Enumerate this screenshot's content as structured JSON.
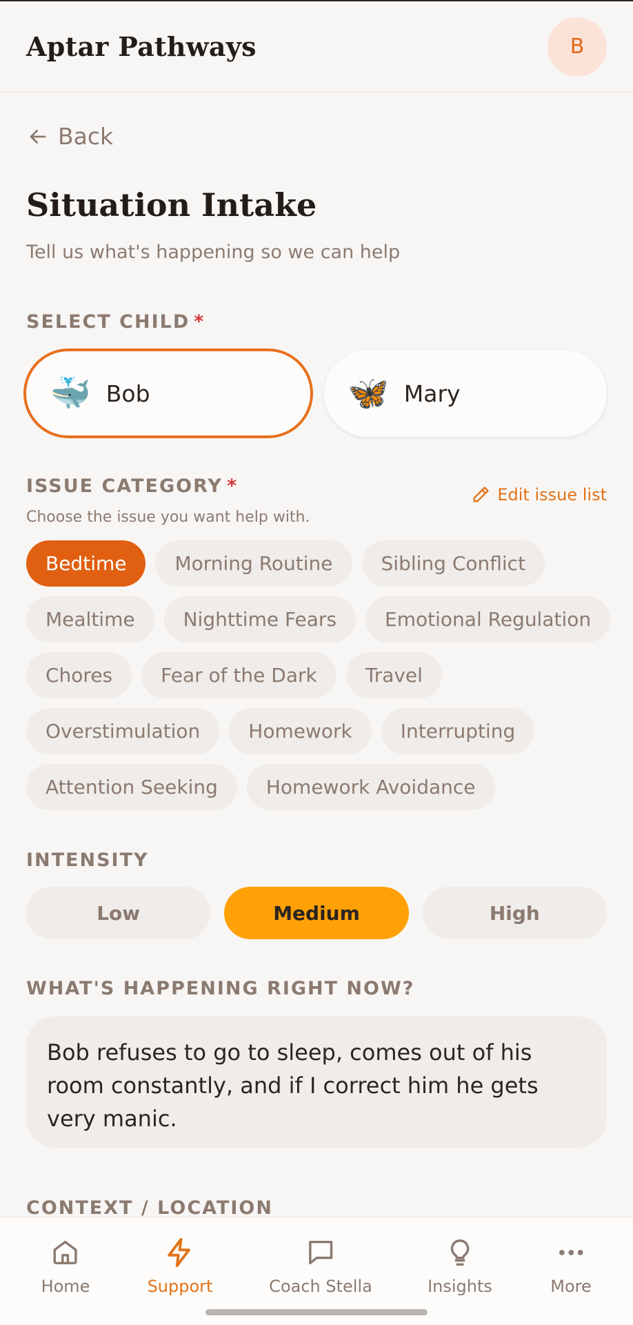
{
  "header": {
    "app_title": "Aptar Pathways",
    "avatar_initial": "B"
  },
  "nav": {
    "back_label": "Back"
  },
  "page": {
    "title": "Situation Intake",
    "subtitle": "Tell us what's happening so we can help"
  },
  "select_child": {
    "label": "SELECT CHILD",
    "required_mark": "*",
    "children": [
      {
        "name": "Bob",
        "emoji": "🐳",
        "selected": true
      },
      {
        "name": "Mary",
        "emoji": "🦋",
        "selected": false
      }
    ]
  },
  "issue_category": {
    "label": "ISSUE CATEGORY",
    "required_mark": "*",
    "edit_link": "Edit issue list",
    "hint": "Choose the issue you want help with.",
    "chips": [
      "Bedtime",
      "Morning Routine",
      "Sibling Conflict",
      "Mealtime",
      "Nighttime Fears",
      "Emotional Regulation",
      "Chores",
      "Fear of the Dark",
      "Travel",
      "Overstimulation",
      "Homework",
      "Interrupting",
      "Attention Seeking",
      "Homework Avoidance"
    ],
    "selected": "Bedtime"
  },
  "intensity": {
    "label": "INTENSITY",
    "options": [
      "Low",
      "Medium",
      "High"
    ],
    "selected": "Medium"
  },
  "happening": {
    "label": "WHAT'S HAPPENING RIGHT NOW?",
    "value": "Bob refuses to go to sleep, comes out of his room constantly, and if I correct him he gets very manic."
  },
  "context": {
    "label": "CONTEXT / LOCATION"
  },
  "bottom_nav": {
    "items": [
      {
        "label": "Home",
        "icon": "home-icon"
      },
      {
        "label": "Support",
        "icon": "bolt-icon",
        "active": true
      },
      {
        "label": "Coach Stella",
        "icon": "chat-icon"
      },
      {
        "label": "Insights",
        "icon": "lightbulb-icon"
      },
      {
        "label": "More",
        "icon": "more-icon"
      }
    ]
  },
  "colors": {
    "accent": "#e05f10",
    "intensity_active": "#ffa106",
    "background": "#f8f6f4"
  }
}
